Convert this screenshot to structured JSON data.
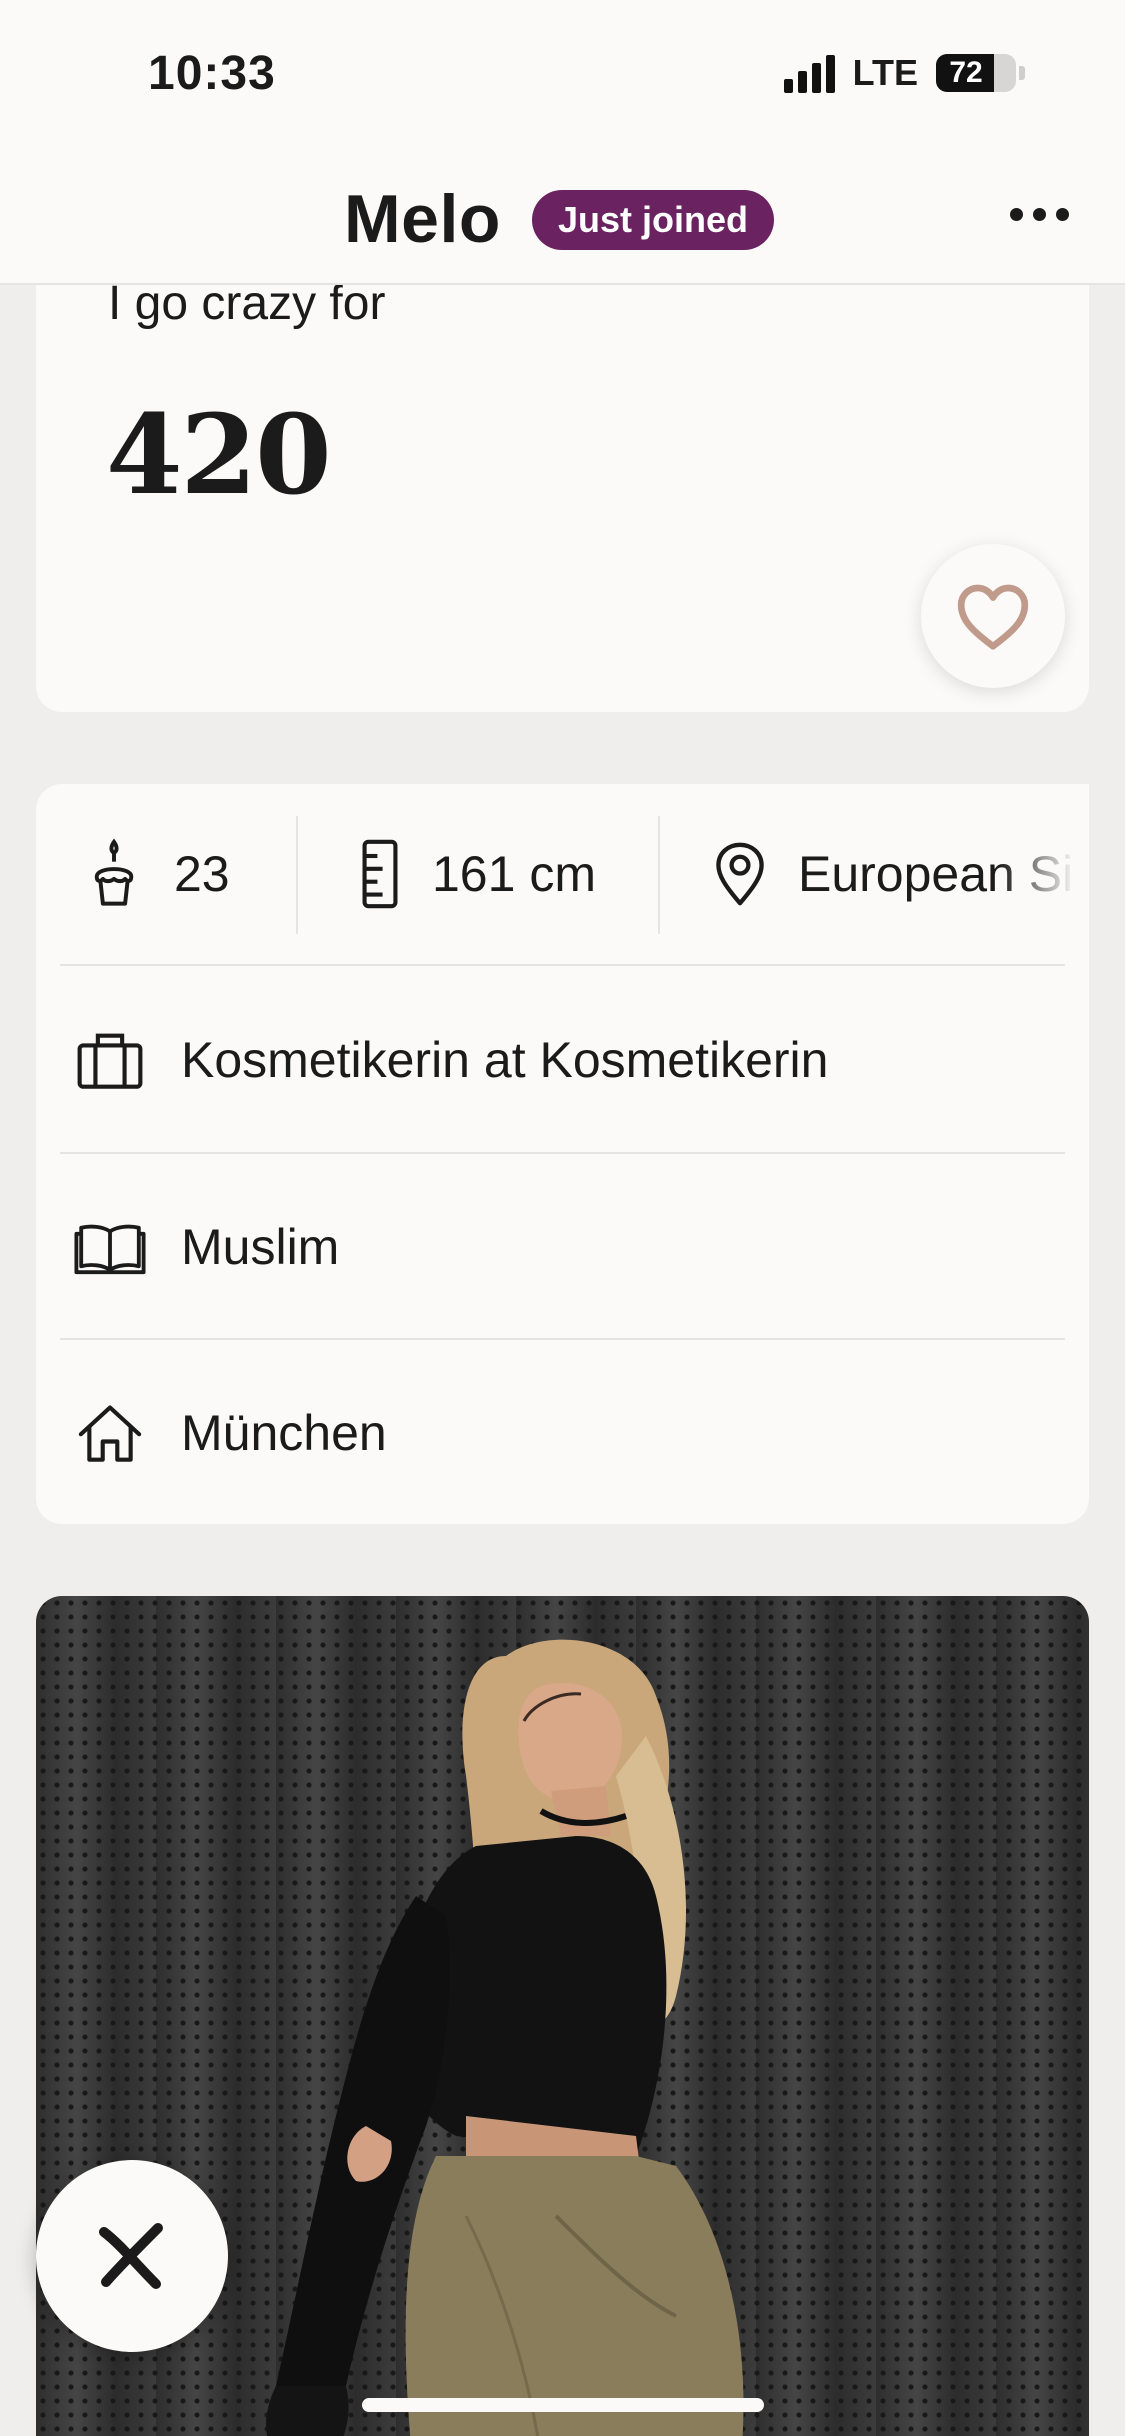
{
  "status_bar": {
    "time": "10:33",
    "network": "LTE",
    "battery": "72",
    "battery_level": 0.72
  },
  "header": {
    "name": "Melo",
    "badge": "Just joined",
    "more_icon": "more-horizontal-icon"
  },
  "prompt": {
    "question": "I go crazy for",
    "answer": "420",
    "like_icon": "heart-icon"
  },
  "info": {
    "age": {
      "icon": "cake-icon",
      "value": "23"
    },
    "height": {
      "icon": "ruler-icon",
      "value": "161 cm"
    },
    "location": {
      "icon": "map-pin-icon",
      "value": "European Si"
    },
    "rows": [
      {
        "icon": "briefcase-icon",
        "label": "Kosmetikerin at Kosmetikerin"
      },
      {
        "icon": "book-icon",
        "label": "Muslim"
      },
      {
        "icon": "home-icon",
        "label": "München"
      }
    ]
  },
  "actions": {
    "pass_icon": "close-icon"
  },
  "colors": {
    "badge": "#6a2360",
    "heart": "#c09a8a",
    "background": "#efeeec",
    "card": "#fbfaf8"
  }
}
